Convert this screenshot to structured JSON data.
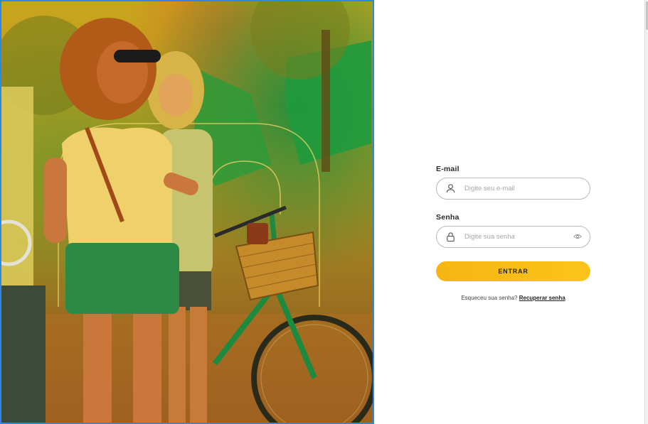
{
  "hero": {
    "icon": "people-with-bicycle-photo"
  },
  "login": {
    "email": {
      "label": "E-mail",
      "placeholder": "Digite seu e-mail",
      "value": "",
      "icon": "user-icon"
    },
    "password": {
      "label": "Senha",
      "placeholder": "Digite sua senha",
      "value": "",
      "icon": "lock-icon",
      "toggle_icon": "eye-icon"
    },
    "submit_label": "ENTRAR",
    "forgot_text": "Esqueceu sua senha?",
    "recover_link": "Recuperar senha"
  },
  "colors": {
    "accent": "#fcc41a",
    "hero_border": "#2f86e6"
  }
}
